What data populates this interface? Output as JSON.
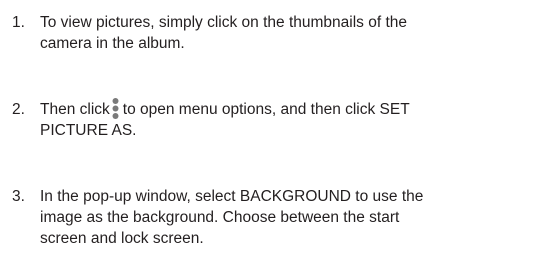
{
  "steps": [
    {
      "number": "1.",
      "lines": [
        "To view pictures, simply click on the thumbnails of the",
        "camera in the album."
      ]
    },
    {
      "number": "2.",
      "line1_before_icon": "Then click",
      "line1_after_icon": "to open menu options, and then click SET",
      "line2": "PICTURE AS.",
      "icon": "more-options-vertical-dots-icon"
    },
    {
      "number": "3.",
      "lines": [
        "In the pop-up window, select BACKGROUND to use the",
        "image as the background. Choose between the start",
        "screen and lock screen."
      ]
    }
  ],
  "colors": {
    "text": "#231f20",
    "icon": "#7a7a7a"
  }
}
